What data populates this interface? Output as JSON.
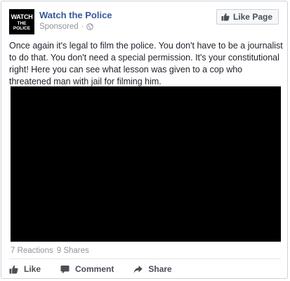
{
  "post": {
    "page_name": "Watch the Police",
    "avatar_text_line1": "WATCH",
    "avatar_text_line2": "THE POLICE",
    "sponsored_label": "Sponsored",
    "separator": "·",
    "audience_icon": "globe-icon",
    "like_page_label": "Like Page",
    "text": "Once again it's legal to film the police. You don't have to be a journalist to do that. You don't need a special permission. It's your constitutional right! Here you can see what lesson was given to a cop who threatened man with jail for filming him.",
    "reactions": "7 Reactions",
    "shares": "9 Shares"
  },
  "actions": {
    "like": "Like",
    "comment": "Comment",
    "share": "Share"
  },
  "colors": {
    "link": "#365899",
    "meta": "#90949c",
    "action_text": "#4b4f56",
    "video_background": "#000000"
  }
}
